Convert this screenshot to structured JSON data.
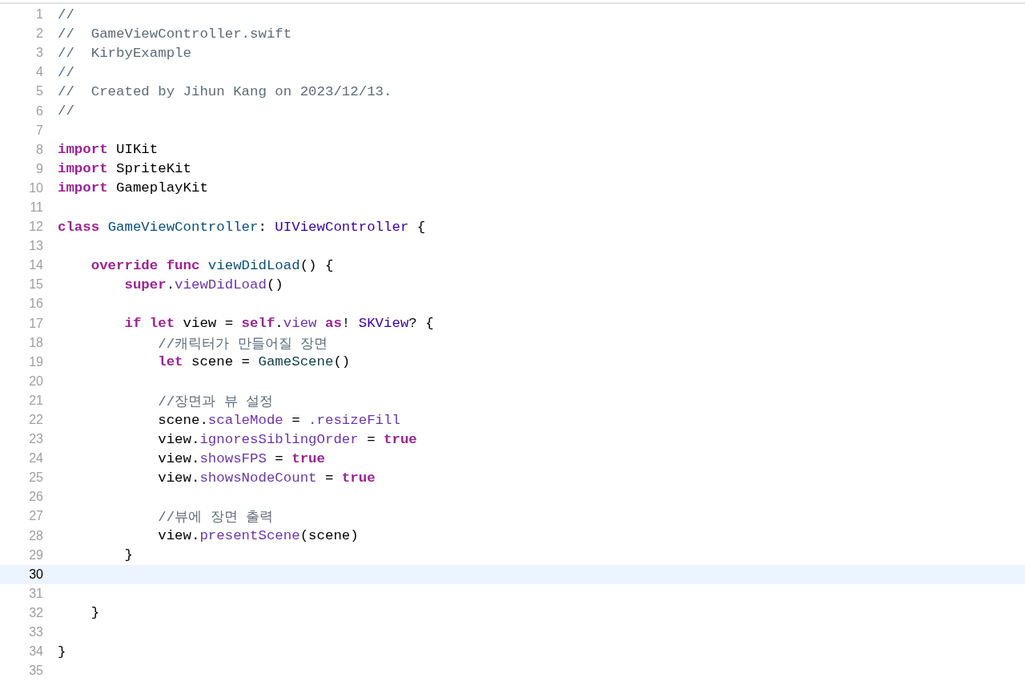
{
  "editor": {
    "lines": [
      {
        "number": "1",
        "selected": false,
        "tokens": [
          {
            "kind": "comment",
            "text": "//"
          }
        ]
      },
      {
        "number": "2",
        "selected": false,
        "tokens": [
          {
            "kind": "comment",
            "text": "//  GameViewController.swift"
          }
        ]
      },
      {
        "number": "3",
        "selected": false,
        "tokens": [
          {
            "kind": "comment",
            "text": "//  KirbyExample"
          }
        ]
      },
      {
        "number": "4",
        "selected": false,
        "tokens": [
          {
            "kind": "comment",
            "text": "//"
          }
        ]
      },
      {
        "number": "5",
        "selected": false,
        "tokens": [
          {
            "kind": "comment",
            "text": "//  Created by Jihun Kang on 2023/12/13."
          }
        ]
      },
      {
        "number": "6",
        "selected": false,
        "tokens": [
          {
            "kind": "comment",
            "text": "//"
          }
        ]
      },
      {
        "number": "7",
        "selected": false
      },
      {
        "number": "8",
        "selected": false,
        "tokens": [
          {
            "kind": "keyword",
            "text": "import"
          },
          {
            "kind": "plain",
            "text": " UIKit"
          }
        ]
      },
      {
        "number": "9",
        "selected": false,
        "tokens": [
          {
            "kind": "keyword",
            "text": "import"
          },
          {
            "kind": "plain",
            "text": " SpriteKit"
          }
        ]
      },
      {
        "number": "10",
        "selected": false,
        "tokens": [
          {
            "kind": "keyword",
            "text": "import"
          },
          {
            "kind": "plain",
            "text": " GameplayKit"
          }
        ]
      },
      {
        "number": "11",
        "selected": false
      },
      {
        "number": "12",
        "selected": false,
        "tokens": [
          {
            "kind": "keyword",
            "text": "class "
          },
          {
            "kind": "decl",
            "text": "GameViewController"
          },
          {
            "kind": "plain",
            "text": ": "
          },
          {
            "kind": "systype",
            "text": "UIViewController"
          },
          {
            "kind": "plain",
            "text": " {"
          }
        ]
      },
      {
        "number": "13",
        "selected": false
      },
      {
        "number": "14",
        "selected": false,
        "tokens": [
          {
            "kind": "keyword",
            "text": "    override func "
          },
          {
            "kind": "decl",
            "text": "viewDidLoad"
          },
          {
            "kind": "plain",
            "text": "() {"
          }
        ]
      },
      {
        "number": "15",
        "selected": false,
        "tokens": [
          {
            "kind": "keyword",
            "text": "        super"
          },
          {
            "kind": "plain",
            "text": "."
          },
          {
            "kind": "member",
            "text": "viewDidLoad"
          },
          {
            "kind": "plain",
            "text": "()"
          }
        ]
      },
      {
        "number": "16",
        "selected": false
      },
      {
        "number": "17",
        "selected": false,
        "tokens": [
          {
            "kind": "keyword",
            "text": "        if let"
          },
          {
            "kind": "plain",
            "text": " view = "
          },
          {
            "kind": "keyword",
            "text": "self"
          },
          {
            "kind": "plain",
            "text": "."
          },
          {
            "kind": "member",
            "text": "view "
          },
          {
            "kind": "keyword",
            "text": "as"
          },
          {
            "kind": "plain",
            "text": "! "
          },
          {
            "kind": "systype",
            "text": "SKView"
          },
          {
            "kind": "plain",
            "text": "? {"
          }
        ]
      },
      {
        "number": "18",
        "selected": false,
        "tokens": [
          {
            "kind": "comment",
            "text": "            //캐릭터가 만들어질 장면"
          }
        ]
      },
      {
        "number": "19",
        "selected": false,
        "tokens": [
          {
            "kind": "keyword",
            "text": "            let"
          },
          {
            "kind": "plain",
            "text": " scene = "
          },
          {
            "kind": "projtype",
            "text": "GameScene"
          },
          {
            "kind": "plain",
            "text": "()"
          }
        ]
      },
      {
        "number": "20",
        "selected": false
      },
      {
        "number": "21",
        "selected": false,
        "tokens": [
          {
            "kind": "comment",
            "text": "            //장면과 뷰 설정"
          }
        ]
      },
      {
        "number": "22",
        "selected": false,
        "tokens": [
          {
            "kind": "plain",
            "text": "            scene."
          },
          {
            "kind": "member",
            "text": "scaleMode"
          },
          {
            "kind": "plain",
            "text": " = "
          },
          {
            "kind": "member",
            "text": ".resizeFill"
          }
        ]
      },
      {
        "number": "23",
        "selected": false,
        "tokens": [
          {
            "kind": "plain",
            "text": "            view."
          },
          {
            "kind": "member",
            "text": "ignoresSiblingOrder"
          },
          {
            "kind": "plain",
            "text": " = "
          },
          {
            "kind": "keyword",
            "text": "true"
          }
        ]
      },
      {
        "number": "24",
        "selected": false,
        "tokens": [
          {
            "kind": "plain",
            "text": "            view."
          },
          {
            "kind": "member",
            "text": "showsFPS"
          },
          {
            "kind": "plain",
            "text": " = "
          },
          {
            "kind": "keyword",
            "text": "true"
          }
        ]
      },
      {
        "number": "25",
        "selected": false,
        "tokens": [
          {
            "kind": "plain",
            "text": "            view."
          },
          {
            "kind": "member",
            "text": "showsNodeCount"
          },
          {
            "kind": "plain",
            "text": " = "
          },
          {
            "kind": "keyword",
            "text": "true"
          }
        ]
      },
      {
        "number": "26",
        "selected": false
      },
      {
        "number": "27",
        "selected": false,
        "tokens": [
          {
            "kind": "comment",
            "text": "            //뷰에 장면 출력"
          }
        ]
      },
      {
        "number": "28",
        "selected": false,
        "tokens": [
          {
            "kind": "plain",
            "text": "            view."
          },
          {
            "kind": "member",
            "text": "presentScene"
          },
          {
            "kind": "plain",
            "text": "(scene)"
          }
        ]
      },
      {
        "number": "29",
        "selected": false,
        "tokens": [
          {
            "kind": "plain",
            "text": "        }"
          }
        ]
      },
      {
        "number": "30",
        "selected": true
      },
      {
        "number": "31",
        "selected": false
      },
      {
        "number": "32",
        "selected": false,
        "tokens": [
          {
            "kind": "plain",
            "text": "    }"
          }
        ]
      },
      {
        "number": "33",
        "selected": false
      },
      {
        "number": "34",
        "selected": false,
        "tokens": [
          {
            "kind": "plain",
            "text": "}"
          }
        ]
      },
      {
        "number": "35",
        "selected": false
      }
    ]
  }
}
